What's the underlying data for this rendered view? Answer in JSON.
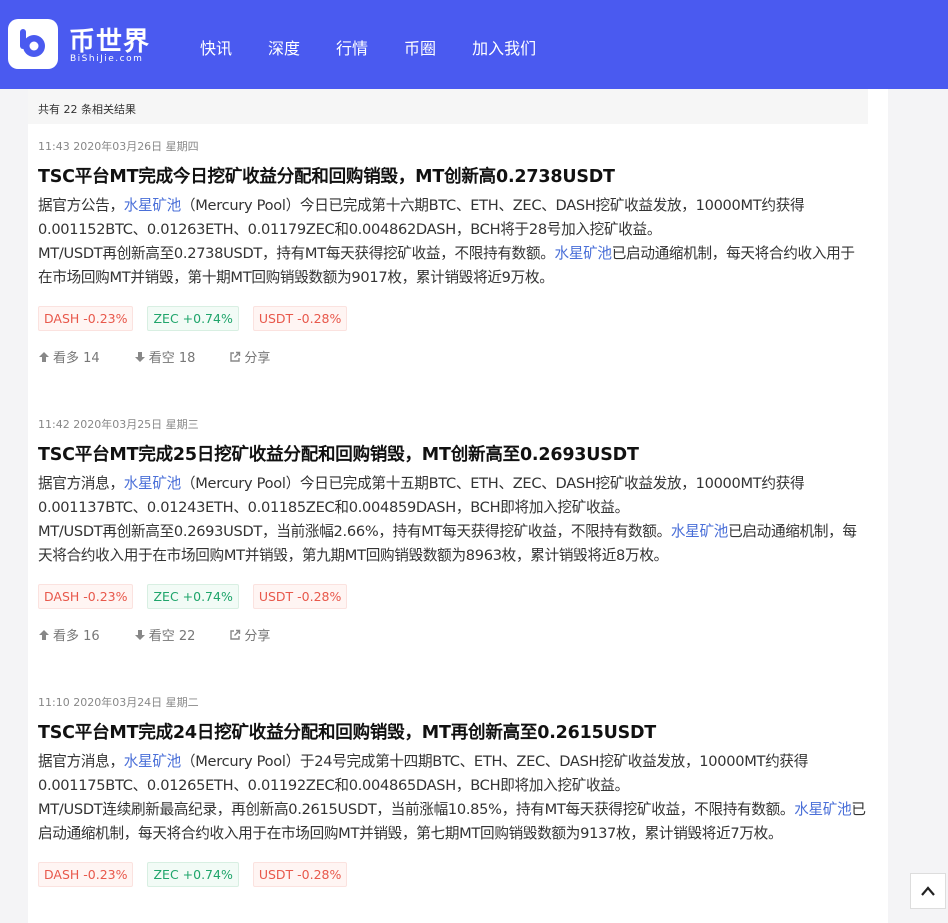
{
  "header": {
    "brand_cn": "币世界",
    "brand_en": "BiShiJie.com",
    "nav": [
      "快讯",
      "深度",
      "行情",
      "币圈",
      "加入我们"
    ]
  },
  "results": {
    "summary": "共有 22 条相关结果"
  },
  "articles": [
    {
      "time": "11:43 2020年03月26日 星期四",
      "title": "TSC平台MT完成今日挖矿收益分配和回购销毁，MT创新高0.2738USDT",
      "p1_pre": "据官方公告，",
      "p1_link": "水星矿池",
      "p1_post": "（Mercury Pool）今日已完成第十六期BTC、ETH、ZEC、DASH挖矿收益发放，10000MT约获得0.001152BTC、0.01263ETH、0.01179ZEC和0.004862DASH，BCH将于28号加入挖矿收益。",
      "p2_pre": "MT/USDT再创新高至0.2738USDT，持有MT每天获得挖矿收益，不限持有数额。",
      "p2_link": "水星矿池",
      "p2_post": "已启动通缩机制，每天将合约收入用于在市场回购MT并销毁，第十期MT回购销毁数额为9017枚，累计销毁将近9万枚。",
      "tags": [
        "DASH -0.23%",
        "ZEC +0.74%",
        "USDT -0.28%"
      ],
      "bull": "看多 14",
      "bear": "看空 18",
      "share": "分享"
    },
    {
      "time": "11:42 2020年03月25日 星期三",
      "title": "TSC平台MT完成25日挖矿收益分配和回购销毁，MT创新高至0.2693USDT",
      "p1_pre": "据官方消息，",
      "p1_link": "水星矿池",
      "p1_post": "（Mercury Pool）今日已完成第十五期BTC、ETH、ZEC、DASH挖矿收益发放，10000MT约获得0.001137BTC、0.01243ETH、0.01185ZEC和0.004859DASH，BCH即将加入挖矿收益。",
      "p2_pre": "MT/USDT再创新高至0.2693USDT，当前涨幅2.66%，持有MT每天获得挖矿收益，不限持有数额。",
      "p2_link": "水星矿池",
      "p2_post": "已启动通缩机制，每天将合约收入用于在市场回购MT并销毁，第九期MT回购销毁数额为8963枚，累计销毁将近8万枚。",
      "tags": [
        "DASH -0.23%",
        "ZEC +0.74%",
        "USDT -0.28%"
      ],
      "bull": "看多 16",
      "bear": "看空 22",
      "share": "分享"
    },
    {
      "time": "11:10 2020年03月24日 星期二",
      "title": "TSC平台MT完成24日挖矿收益分配和回购销毁，MT再创新高至0.2615USDT",
      "p1_pre": "据官方消息，",
      "p1_link": "水星矿池",
      "p1_post": "（Mercury Pool）于24号完成第十四期BTC、ETH、ZEC、DASH挖矿收益发放，10000MT约获得0.001175BTC、0.01265ETH、0.01192ZEC和0.004865DASH，BCH即将加入挖矿收益。",
      "p2_pre": "MT/USDT连续刷新最高纪录，再创新高0.2615USDT，当前涨幅10.85%，持有MT每天获得挖矿收益，不限持有数额。",
      "p2_link": "水星矿池",
      "p2_post": "已启动通缩机制，每天将合约收入用于在市场回购MT并销毁，第七期MT回购销毁数额为9137枚，累计销毁将近7万枚。",
      "tags": [
        "DASH -0.23%",
        "ZEC +0.74%",
        "USDT -0.28%"
      ]
    }
  ]
}
